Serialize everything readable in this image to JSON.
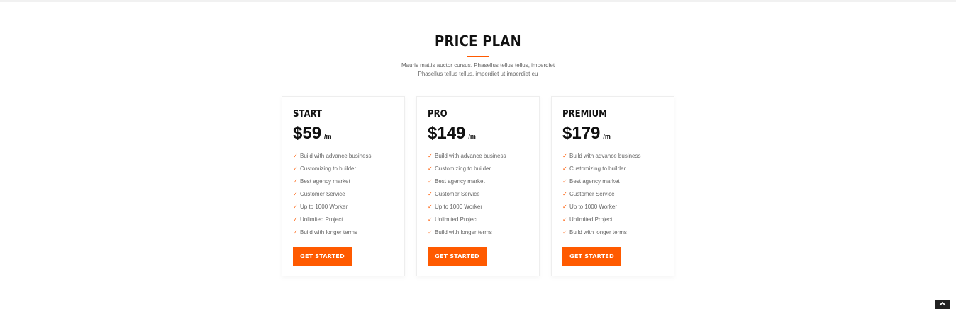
{
  "header": {
    "title": "PRICE PLAN",
    "subtitle_line1": "Mauris mattis auctor cursus. Phasellus tellus tellus, imperdiet",
    "subtitle_line2": "Phasellus tellus tellus, imperdiet ut imperdiet eu"
  },
  "colors": {
    "accent": "#ff5a00",
    "text_dark": "#111111",
    "text_muted": "#666666"
  },
  "plans": [
    {
      "name": "START",
      "price": "$59",
      "period": "/m",
      "features": [
        "Build with advance business",
        "Customizing to builder",
        "Best agency market",
        "Customer Service",
        "Up to 1000 Worker",
        "Unlimited Project",
        "Build with longer terms"
      ],
      "button_label": "GET STARTED"
    },
    {
      "name": "PRO",
      "price": "$149",
      "period": "/m",
      "features": [
        "Build with advance business",
        "Customizing to builder",
        "Best agency market",
        "Customer Service",
        "Up to 1000 Worker",
        "Unlimited Project",
        "Build with longer terms"
      ],
      "button_label": "GET STARTED"
    },
    {
      "name": "PREMIUM",
      "price": "$179",
      "period": "/m",
      "features": [
        "Build with advance business",
        "Customizing to builder",
        "Best agency market",
        "Customer Service",
        "Up to 1000 Worker",
        "Unlimited Project",
        "Build with longer terms"
      ],
      "button_label": "GET STARTED"
    }
  ],
  "icons": {
    "feature_check": "check-icon",
    "back_to_top": "chevron-up-icon"
  }
}
